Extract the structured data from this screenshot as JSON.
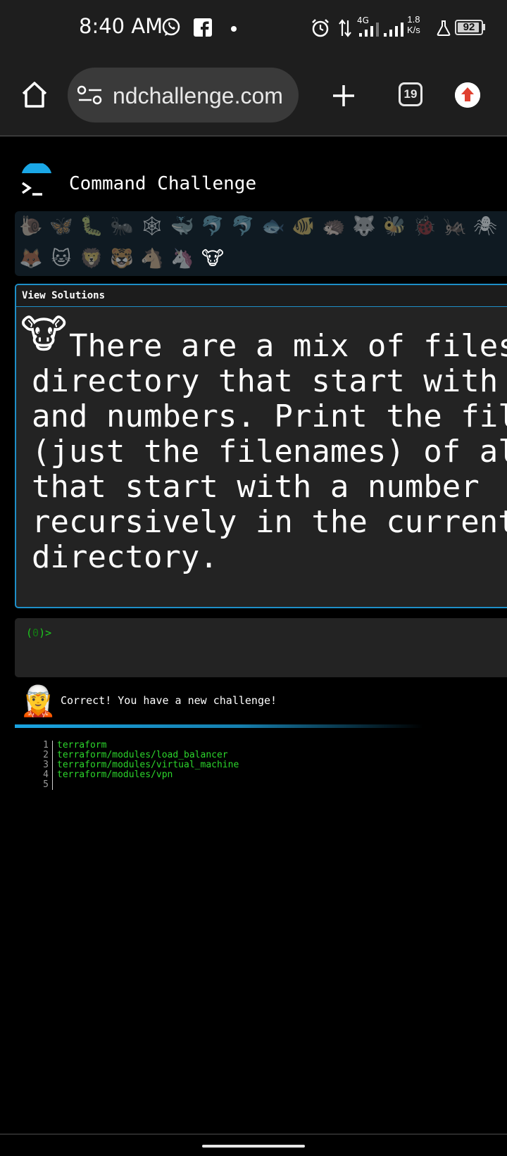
{
  "status_bar": {
    "time": "8:40 AM",
    "network_type": "4G",
    "speed_value": "1.8",
    "speed_unit": "K/s",
    "battery_level": "92",
    "icons": [
      "whatsapp-icon",
      "facebook-icon",
      "notification-dot-icon",
      "alarm-icon",
      "data-transfer-icon",
      "signal-icon",
      "signal-icon",
      "lab-flask-icon",
      "battery-icon"
    ]
  },
  "browser": {
    "url": "ndchallenge.com",
    "tab_count": "19",
    "icons": [
      "home-icon",
      "site-settings-icon",
      "new-tab-icon",
      "tab-switcher-icon",
      "update-icon"
    ]
  },
  "site": {
    "title": "Command Challenge",
    "logo_icon": "terminal-prompt-icon"
  },
  "progress_emojis": {
    "row1": [
      "🐌",
      "🦋",
      "🐛",
      "🐜",
      "🕸",
      "🐳",
      "🐬",
      "🐬",
      "🐟",
      "🐠",
      "🦔",
      "🐺",
      "🐝",
      "🐞",
      "🦗",
      "🕷"
    ],
    "row2": [
      "🦊",
      "🐱",
      "🦁",
      "🐯",
      "🐴",
      "🦄",
      "🐮"
    ]
  },
  "challenge": {
    "header": "View Solutions",
    "emoji": "🐮",
    "lines": [
      "  There are a mix of files",
      "directory that start with l",
      "and numbers. Print the file",
      "(just the filenames) of all",
      "that start with a number",
      "recursively in the current",
      "directory."
    ]
  },
  "prompt": {
    "open": "(",
    "count": "0",
    "close": ")>"
  },
  "feedback": {
    "avatar": "🧝",
    "message": "Correct! You have a new challenge!"
  },
  "output": [
    {
      "n": "1",
      "text": "terraform"
    },
    {
      "n": "2",
      "text": "terraform/modules/load_balancer"
    },
    {
      "n": "3",
      "text": "terraform/modules/virtual_machine"
    },
    {
      "n": "4",
      "text": "terraform/modules/vpn"
    },
    {
      "n": "5",
      "text": ""
    }
  ],
  "colors": {
    "accent_blue": "#1e8fc8",
    "prompt_green": "#1ec81e",
    "output_green": "#2cd62c",
    "update_red": "#e04030"
  }
}
